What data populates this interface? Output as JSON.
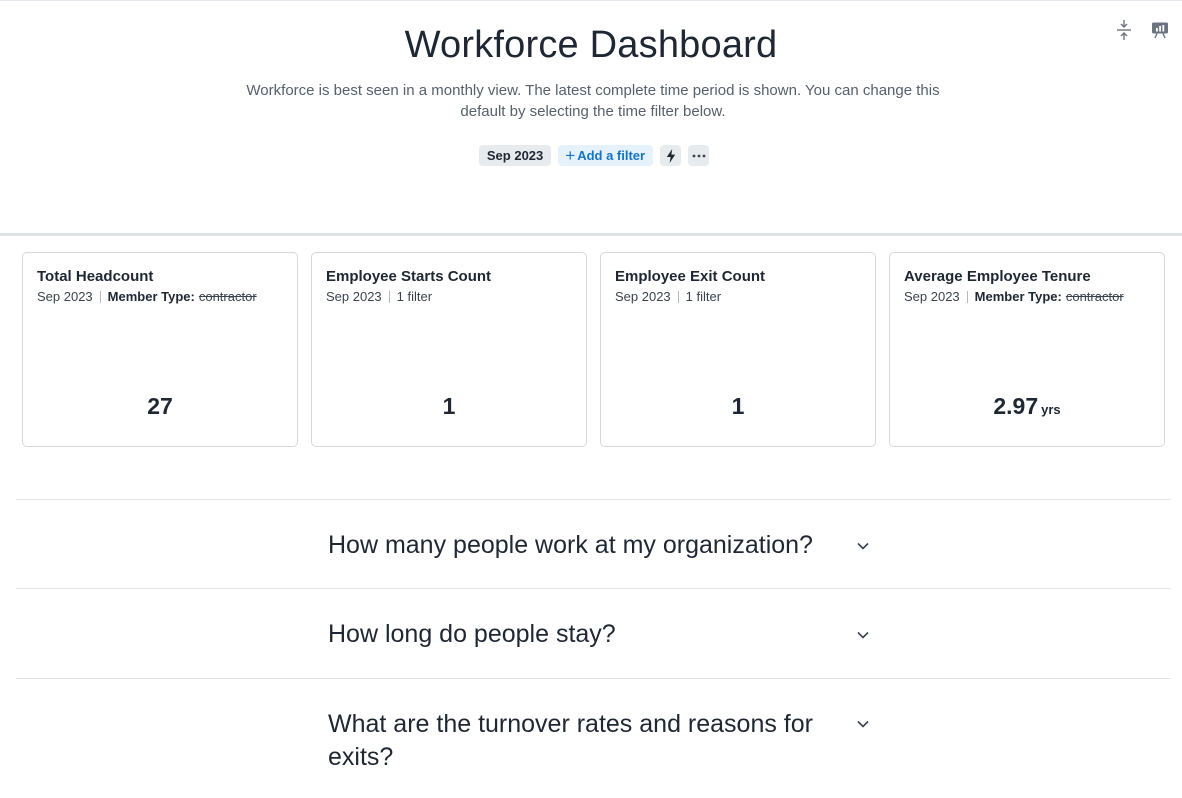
{
  "header": {
    "title": "Workforce Dashboard",
    "subtitle": "Workforce is best seen in a monthly view. The latest complete time period is shown. You can change this default by selecting the time filter below.",
    "filters": {
      "date_chip": "Sep 2023",
      "add_filter_plus": "+",
      "add_filter_label": "Add a filter",
      "more_label": "···"
    }
  },
  "icons": {
    "expand_collapse": "expand-collapse-icon",
    "presentation": "presentation-chart-icon",
    "lightning": "lightning-icon",
    "chevron": "chevron-down-icon"
  },
  "cards": [
    {
      "title": "Total Headcount",
      "period": "Sep 2023",
      "filter_key": "Member Type:",
      "filter_value": "contractor",
      "value": "27",
      "unit": ""
    },
    {
      "title": "Employee Starts Count",
      "period": "Sep 2023",
      "filter_text": "1 filter",
      "value": "1",
      "unit": ""
    },
    {
      "title": "Employee Exit Count",
      "period": "Sep 2023",
      "filter_text": "1 filter",
      "value": "1",
      "unit": ""
    },
    {
      "title": "Average Employee Tenure",
      "period": "Sep 2023",
      "filter_key": "Member Type:",
      "filter_value": "contractor",
      "value": "2.97",
      "unit": "yrs"
    }
  ],
  "sections": [
    {
      "question": "How many people work at my organization?"
    },
    {
      "question": "How long do people stay?"
    },
    {
      "question": "What are the turnover rates and reasons for exits?"
    }
  ],
  "colors": {
    "text": "#1f2733",
    "accent": "#1474c4",
    "chip_bg": "#e8ebee",
    "add_filter_bg": "#e6f2fb",
    "border": "#d5d9de"
  }
}
